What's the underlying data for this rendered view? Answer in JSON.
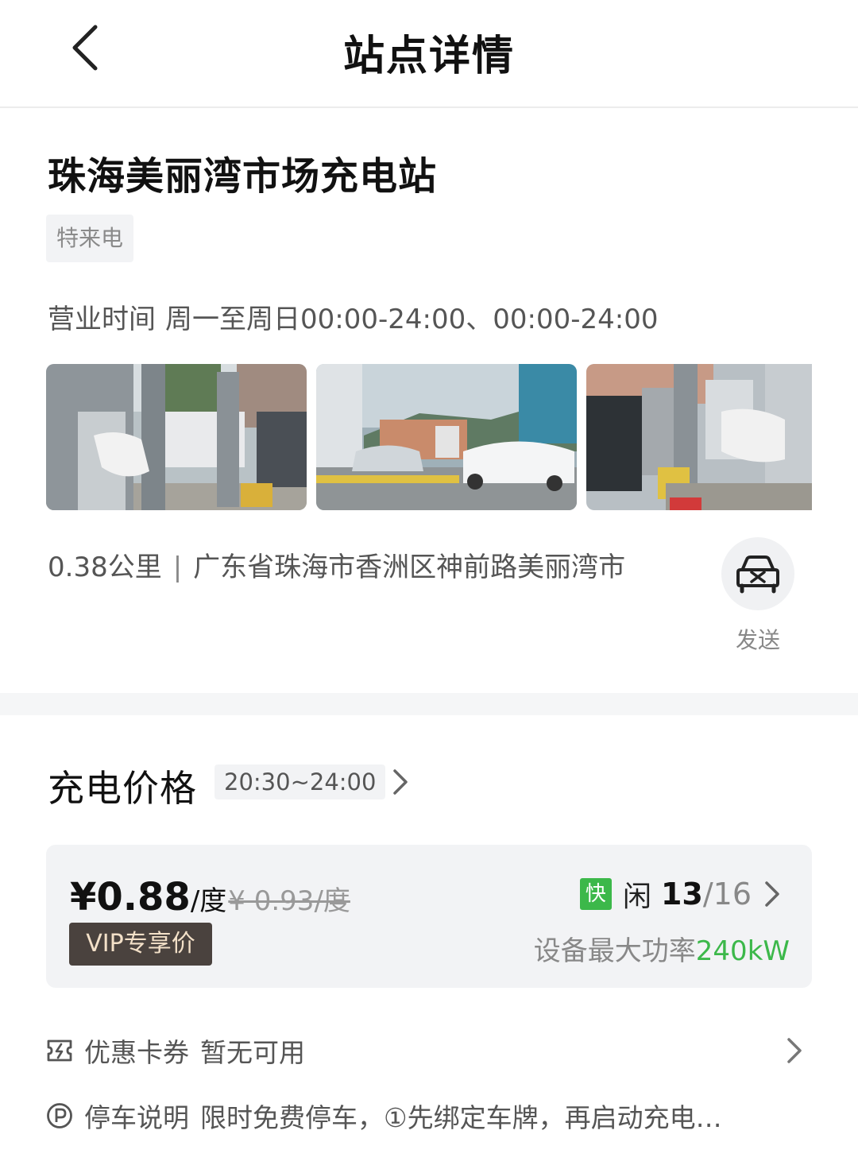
{
  "header": {
    "title": "站点详情",
    "back_icon": "chevron-left-icon"
  },
  "station": {
    "name": "珠海美丽湾市场充电站",
    "operator_tag": "特来电",
    "hours_label": "营业时间",
    "hours_value": "周一至周日00:00-24:00、00:00-24:00",
    "distance": "0.38公里",
    "separator": "|",
    "address": "广东省珠海市香洲区神前路美丽湾市",
    "send_label": "发送",
    "send_icon": "car-icon"
  },
  "photos": [
    {
      "id": "photo-1"
    },
    {
      "id": "photo-2"
    },
    {
      "id": "photo-3"
    }
  ],
  "price": {
    "heading": "充电价格",
    "time_range": "20:30~24:00",
    "current_price": "¥0.88",
    "unit": "/度",
    "original_price": "¥ 0.93/度",
    "vip_label": "VIP专享价",
    "fast_badge": "快",
    "idle_label": "闲",
    "idle_count": "13",
    "total_count": "/16",
    "power_label": "设备最大功率",
    "power_value": "240kW",
    "accent_color": "#3cb84a"
  },
  "coupon": {
    "label": "优惠卡券",
    "value": "暂无可用",
    "icon": "coupon-icon"
  },
  "parking": {
    "label": "停车说明",
    "value": "限时免费停车，①先绑定车牌，再启动充电…",
    "icon": "parking-icon"
  }
}
